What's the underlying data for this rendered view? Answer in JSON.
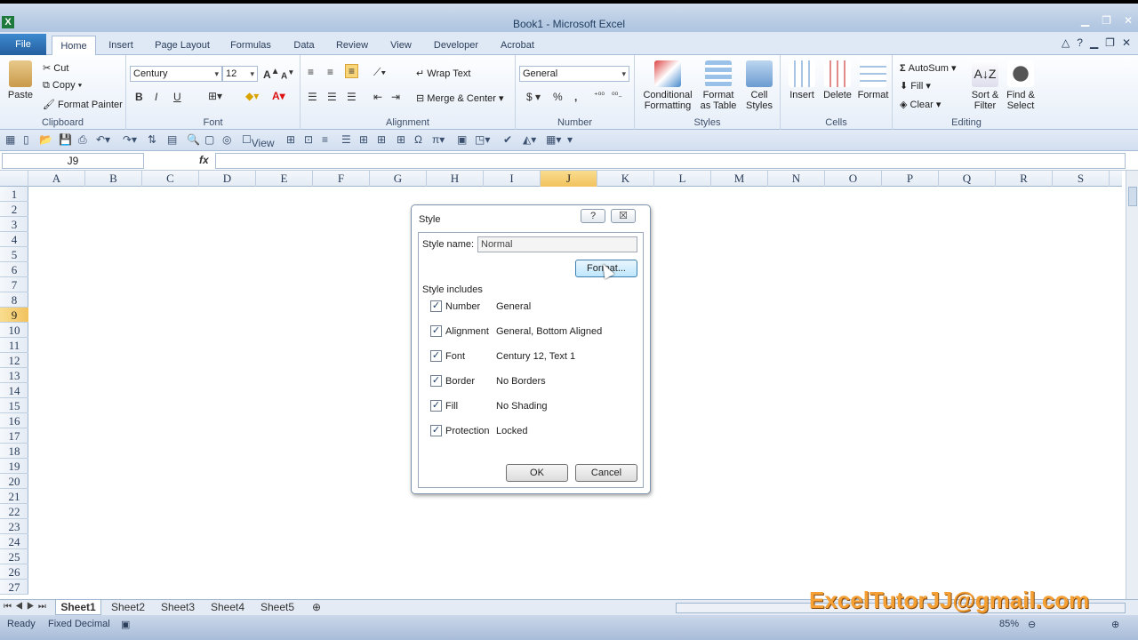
{
  "window": {
    "title": "Book1 - Microsoft Excel",
    "app_icon": "X"
  },
  "tabs": [
    "File",
    "Home",
    "Insert",
    "Page Layout",
    "Formulas",
    "Data",
    "Review",
    "View",
    "Developer",
    "Acrobat"
  ],
  "ribbon": {
    "clipboard": {
      "paste": "Paste",
      "cut": "Cut",
      "copy": "Copy",
      "format_painter": "Format Painter",
      "label": "Clipboard"
    },
    "font": {
      "name": "Century",
      "size": "12",
      "label": "Font",
      "bold": "B",
      "italic": "I",
      "underline": "U"
    },
    "alignment": {
      "wrap_text": "Wrap Text",
      "merge_center": "Merge & Center",
      "label": "Alignment"
    },
    "number": {
      "format": "General",
      "currency": "$",
      "percent": "%",
      "comma": ",",
      "label": "Number"
    },
    "styles": {
      "conditional": "Conditional",
      "conditional2": "Formatting",
      "format_table": "Format",
      "format_table2": "as Table",
      "cell_styles": "Cell",
      "cell_styles2": "Styles",
      "label": "Styles"
    },
    "cells": {
      "insert": "Insert",
      "delete": "Delete",
      "format": "Format",
      "label": "Cells"
    },
    "editing": {
      "autosum": "AutoSum",
      "fill": "Fill",
      "clear": "Clear",
      "sort": "Sort &",
      "sort2": "Filter",
      "find": "Find &",
      "find2": "Select",
      "label": "Editing"
    }
  },
  "qat": {
    "view_label": "View"
  },
  "formula_bar": {
    "name_box": "J9",
    "fx": "fx"
  },
  "columns": [
    "A",
    "B",
    "C",
    "D",
    "E",
    "F",
    "G",
    "H",
    "I",
    "J",
    "K",
    "L",
    "M",
    "N",
    "O",
    "P",
    "Q",
    "R",
    "S"
  ],
  "selected_column": "J",
  "rows": [
    "1",
    "2",
    "3",
    "4",
    "5",
    "6",
    "7",
    "8",
    "9",
    "10",
    "11",
    "12",
    "13",
    "14",
    "15",
    "16",
    "17",
    "18",
    "19",
    "20",
    "21",
    "22",
    "23",
    "24",
    "25",
    "26",
    "27"
  ],
  "selected_row": "9",
  "sheets": [
    "Sheet1",
    "Sheet2",
    "Sheet3",
    "Sheet4",
    "Sheet5"
  ],
  "active_sheet": "Sheet1",
  "status": {
    "ready": "Ready",
    "mode": "Fixed Decimal",
    "zoom": "85%"
  },
  "watermark": "ExcelTutorJJ@gmail.com",
  "dialog": {
    "title": "Style",
    "help": "?",
    "close": "☒",
    "style_name_label": "Style name:",
    "style_name_value": "Normal",
    "format_button": "Format...",
    "includes_label": "Style includes",
    "items": [
      {
        "name": "Number",
        "value": "General",
        "checked": true
      },
      {
        "name": "Alignment",
        "value": "General, Bottom Aligned",
        "checked": true
      },
      {
        "name": "Font",
        "value": "Century 12, Text 1",
        "checked": true
      },
      {
        "name": "Border",
        "value": "No Borders",
        "checked": true
      },
      {
        "name": "Fill",
        "value": "No Shading",
        "checked": true
      },
      {
        "name": "Protection",
        "value": "Locked",
        "checked": true
      }
    ],
    "ok": "OK",
    "cancel": "Cancel"
  }
}
